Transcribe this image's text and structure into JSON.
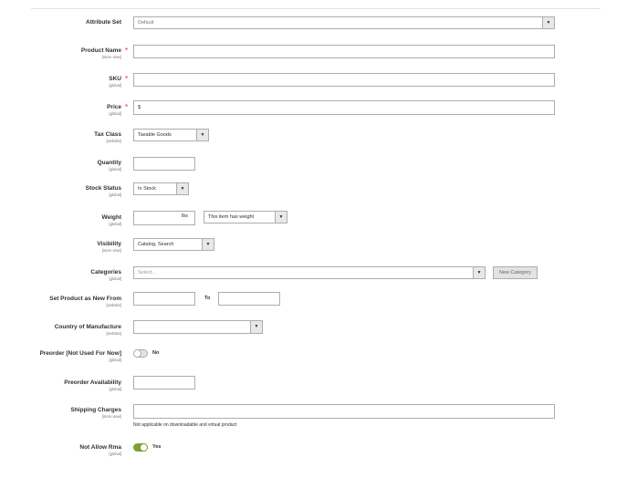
{
  "fields": {
    "attribute_set": {
      "label": "Attribute Set",
      "value": "Default"
    },
    "product_name": {
      "label": "Product Name",
      "scope": "[store view]",
      "required": "*",
      "value": ""
    },
    "sku": {
      "label": "SKU",
      "scope": "[global]",
      "required": "*",
      "value": ""
    },
    "price": {
      "label": "Price",
      "scope": "[global]",
      "required": "*",
      "value": "$"
    },
    "tax_class": {
      "label": "Tax Class",
      "scope": "[website]",
      "value": "Taxable Goods"
    },
    "quantity": {
      "label": "Quantity",
      "scope": "[global]",
      "value": ""
    },
    "stock_status": {
      "label": "Stock Status",
      "scope": "[global]",
      "value": "In Stock"
    },
    "weight": {
      "label": "Weight",
      "scope": "[global]",
      "unit": "lbs",
      "value": "",
      "type_value": "This item has weight"
    },
    "visibility": {
      "label": "Visibility",
      "scope": "[store view]",
      "value": "Catalog, Search"
    },
    "categories": {
      "label": "Categories",
      "scope": "[global]",
      "placeholder": "Select...",
      "new_button": "New Category"
    },
    "new_from": {
      "label": "Set Product as New From",
      "scope": "[website]",
      "to_label": "To"
    },
    "country": {
      "label": "Country of Manufacture",
      "scope": "[website]",
      "value": ""
    },
    "preorder": {
      "label": "Preorder [Not Used For Now]",
      "scope": "[global]",
      "toggle_label": "No"
    },
    "preorder_availability": {
      "label": "Preorder Availability",
      "scope": "[global]",
      "value": ""
    },
    "shipping": {
      "label": "Shipping Charges",
      "scope": "[store view]",
      "note": "Not applicable on downloadable and virtual product"
    },
    "not_allow_rma": {
      "label": "Not Allow Rma",
      "scope": "[global]",
      "toggle_label": "Yes"
    }
  },
  "icons": {
    "dropdown": "▼"
  },
  "colors": {
    "required": "#e22626",
    "toggle_on": "#79a22e",
    "toggle_off": "#e3e3e3"
  }
}
